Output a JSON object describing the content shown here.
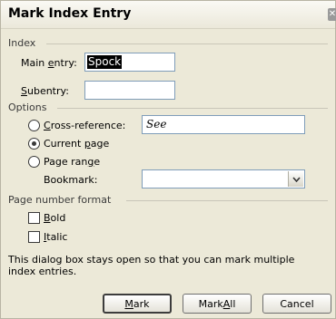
{
  "dialog": {
    "title": "Mark Index Entry",
    "close_glyph": "✕"
  },
  "index_section": {
    "label": "Index",
    "main_entry": {
      "label": "Main ",
      "label_u": "e",
      "label_rest": "ntry:",
      "value": "Spock"
    },
    "subentry": {
      "label_u": "S",
      "label_rest": "ubentry:",
      "value": ""
    }
  },
  "options_section": {
    "label": "Options",
    "cross_reference": {
      "label_u": "C",
      "label_rest": "ross-reference:",
      "value": "See",
      "selected": false
    },
    "current_page": {
      "label": "Current ",
      "label_u": "p",
      "label_rest": "age",
      "selected": true
    },
    "page_range": {
      "label": "Page ran",
      "label_u": "g",
      "label_rest": "e",
      "selected": false
    },
    "bookmark": {
      "label": "Bookmark:",
      "value": ""
    }
  },
  "page_number_format": {
    "label": "Page number format",
    "bold": {
      "label_u": "B",
      "label_rest": "old",
      "checked": false
    },
    "italic": {
      "label_u": "I",
      "label_rest": "talic",
      "checked": false
    }
  },
  "info_text": "This dialog box stays open so that you can mark multiple index entries.",
  "buttons": {
    "mark": {
      "label_u": "M",
      "label_rest": "ark"
    },
    "mark_all": {
      "label": "Mark ",
      "label_u": "A",
      "label_rest": "ll"
    },
    "cancel": {
      "label": "Cancel"
    }
  }
}
